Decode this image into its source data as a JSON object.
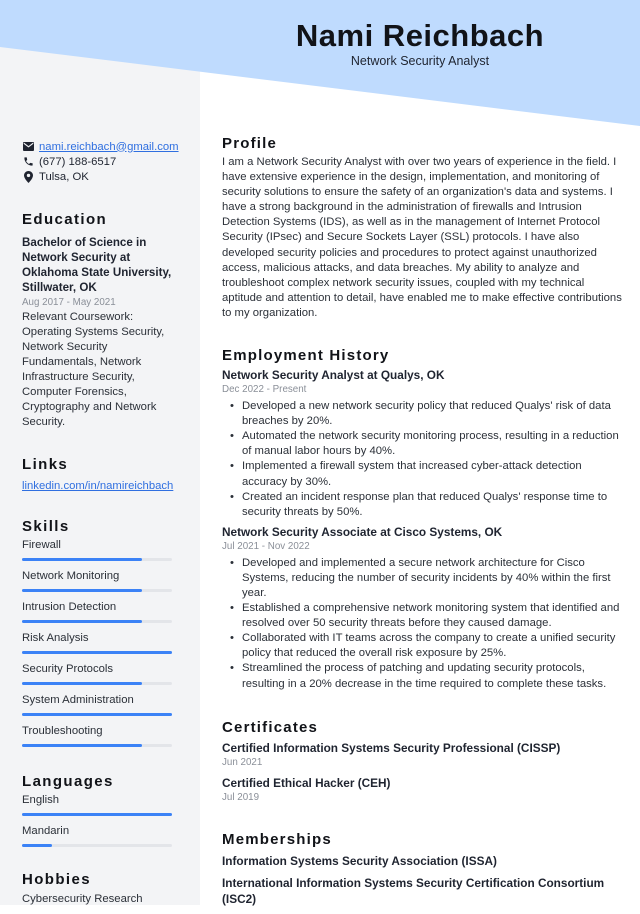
{
  "header": {
    "name": "Nami Reichbach",
    "title": "Network Security Analyst",
    "accent_color": "#bfdbfe"
  },
  "contact": {
    "email": "nami.reichbach@gmail.com",
    "phone": "(677) 188-6517",
    "location": "Tulsa, OK",
    "icons": [
      "envelope-icon",
      "phone-icon",
      "map-pin-icon"
    ]
  },
  "education": {
    "heading": "Education",
    "degree": "Bachelor of Science in Network Security at Oklahoma State University, Stillwater, OK",
    "dates": "Aug 2017 - May 2021",
    "description": "Relevant Coursework: Operating Systems Security, Network Security Fundamentals, Network Infrastructure Security, Computer Forensics, Cryptography and Network Security."
  },
  "links": {
    "heading": "Links",
    "items": [
      "linkedin.com/in/namireichbach"
    ]
  },
  "skills": {
    "heading": "Skills",
    "items": [
      {
        "label": "Firewall",
        "level": 0.8
      },
      {
        "label": "Network Monitoring",
        "level": 0.8
      },
      {
        "label": "Intrusion Detection",
        "level": 0.8
      },
      {
        "label": "Risk Analysis",
        "level": 1.0
      },
      {
        "label": "Security Protocols",
        "level": 0.8
      },
      {
        "label": "System Administration",
        "level": 1.0
      },
      {
        "label": "Troubleshooting",
        "level": 0.8
      }
    ]
  },
  "languages": {
    "heading": "Languages",
    "items": [
      {
        "label": "English",
        "level": 1.0
      },
      {
        "label": "Mandarin",
        "level": 0.2
      }
    ]
  },
  "hobbies": {
    "heading": "Hobbies",
    "items": [
      "Cybersecurity Research"
    ]
  },
  "profile": {
    "heading": "Profile",
    "text": "I am a Network Security Analyst with over two years of experience in the field. I have extensive experience in the design, implementation, and monitoring of security solutions to ensure the safety of an organization's data and systems. I have a strong background in the administration of firewalls and Intrusion Detection Systems (IDS), as well as in the management of Internet Protocol Security (IPsec) and Secure Sockets Layer (SSL) protocols. I have also developed security policies and procedures to protect against unauthorized access, malicious attacks, and data breaches. My ability to analyze and troubleshoot complex network security issues, coupled with my technical aptitude and attention to detail, have enabled me to make effective contributions to my organization."
  },
  "employment": {
    "heading": "Employment History",
    "jobs": [
      {
        "title": "Network Security Analyst at Qualys, OK",
        "dates": "Dec 2022 - Present",
        "bullets": [
          "Developed a new network security policy that reduced Qualys' risk of data breaches by 20%.",
          "Automated the network security monitoring process, resulting in a reduction of manual labor hours by 40%.",
          "Implemented a firewall system that increased cyber-attack detection accuracy by 30%.",
          "Created an incident response plan that reduced Qualys' response time to security threats by 50%."
        ]
      },
      {
        "title": "Network Security Associate at Cisco Systems, OK",
        "dates": "Jul 2021 - Nov 2022",
        "bullets": [
          "Developed and implemented a secure network architecture for Cisco Systems, reducing the number of security incidents by 40% within the first year.",
          "Established a comprehensive network monitoring system that identified and resolved over 50 security threats before they caused damage.",
          "Collaborated with IT teams across the company to create a unified security policy that reduced the overall risk exposure by 25%.",
          "Streamlined the process of patching and updating security protocols, resulting in a 20% decrease in the time required to complete these tasks."
        ]
      }
    ]
  },
  "certificates": {
    "heading": "Certificates",
    "items": [
      {
        "title": "Certified Information Systems Security Professional (CISSP)",
        "date": "Jun 2021"
      },
      {
        "title": "Certified Ethical Hacker (CEH)",
        "date": "Jul 2019"
      }
    ]
  },
  "memberships": {
    "heading": "Memberships",
    "items": [
      "Information Systems Security Association (ISSA)",
      "International Information Systems Security Certification Consortium (ISC2)"
    ]
  }
}
